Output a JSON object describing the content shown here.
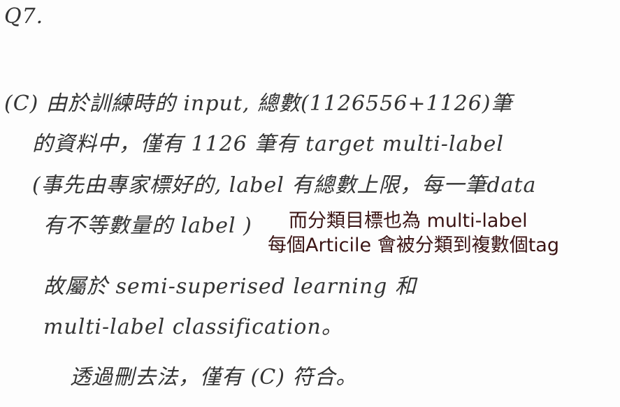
{
  "question": "Q7.",
  "handwritten_lines": [
    "(C) 由於訓練時的 input, 總數(1126556+1126)筆",
    "的資料中，僅有 1126 筆有 target multi-label",
    "(事先由專家標好的, label 有總數上限，每一筆data",
    "有不等數量的 label )",
    "故屬於 semi-superised learning 和",
    "multi-label classification。",
    "透過刪去法，僅有 (C) 符合。"
  ],
  "typed_lines": [
    "而分類目標也為 multi-label",
    "每個Articile 會被分類到複數個tag"
  ]
}
